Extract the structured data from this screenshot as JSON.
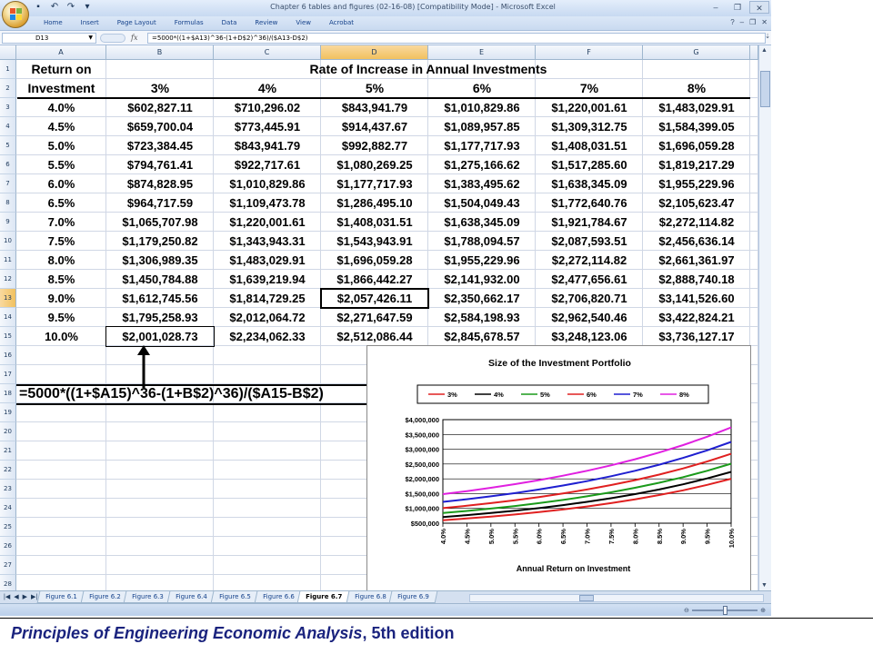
{
  "window": {
    "title": "Chapter 6 tables and figures (02-16-08)  [Compatibility Mode] - Microsoft Excel",
    "controls": [
      "–",
      "❐",
      "✕"
    ]
  },
  "ribbon": {
    "tabs": [
      "Home",
      "Insert",
      "Page Layout",
      "Formulas",
      "Data",
      "Review",
      "View",
      "Acrobat"
    ]
  },
  "formula_bar": {
    "name_box": "D13",
    "fx": "fx",
    "formula": "=5000*((1+$A13)^36-(1+D$2)^36)/($A13-D$2)"
  },
  "columns": [
    "A",
    "B",
    "C",
    "D",
    "E",
    "F",
    "G"
  ],
  "selected_column": "D",
  "rows": [
    "1",
    "2",
    "3",
    "4",
    "5",
    "6",
    "7",
    "8",
    "9",
    "10",
    "11",
    "12",
    "13",
    "14",
    "15",
    "16",
    "17",
    "18",
    "19",
    "20",
    "21",
    "22",
    "23",
    "24",
    "25",
    "26",
    "27",
    "28"
  ],
  "selected_row": "13",
  "table": {
    "header_a1": "Return on",
    "header_a2": "Investment",
    "header_title": "Rate of Increase in Annual Investments",
    "rate_headers": [
      "3%",
      "4%",
      "5%",
      "6%",
      "7%",
      "8%"
    ],
    "rows": [
      {
        "ret": "4.0%",
        "vals": [
          "$602,827.11",
          "$710,296.02",
          "$843,941.79",
          "$1,010,829.86",
          "$1,220,001.61",
          "$1,483,029.91"
        ]
      },
      {
        "ret": "4.5%",
        "vals": [
          "$659,700.04",
          "$773,445.91",
          "$914,437.67",
          "$1,089,957.85",
          "$1,309,312.75",
          "$1,584,399.05"
        ]
      },
      {
        "ret": "5.0%",
        "vals": [
          "$723,384.45",
          "$843,941.79",
          "$992,882.77",
          "$1,177,717.93",
          "$1,408,031.51",
          "$1,696,059.28"
        ]
      },
      {
        "ret": "5.5%",
        "vals": [
          "$794,761.41",
          "$922,717.61",
          "$1,080,269.25",
          "$1,275,166.62",
          "$1,517,285.60",
          "$1,819,217.29"
        ]
      },
      {
        "ret": "6.0%",
        "vals": [
          "$874,828.95",
          "$1,010,829.86",
          "$1,177,717.93",
          "$1,383,495.62",
          "$1,638,345.09",
          "$1,955,229.96"
        ]
      },
      {
        "ret": "6.5%",
        "vals": [
          "$964,717.59",
          "$1,109,473.78",
          "$1,286,495.10",
          "$1,504,049.43",
          "$1,772,640.76",
          "$2,105,623.47"
        ]
      },
      {
        "ret": "7.0%",
        "vals": [
          "$1,065,707.98",
          "$1,220,001.61",
          "$1,408,031.51",
          "$1,638,345.09",
          "$1,921,784.67",
          "$2,272,114.82"
        ]
      },
      {
        "ret": "7.5%",
        "vals": [
          "$1,179,250.82",
          "$1,343,943.31",
          "$1,543,943.91",
          "$1,788,094.57",
          "$2,087,593.51",
          "$2,456,636.14"
        ]
      },
      {
        "ret": "8.0%",
        "vals": [
          "$1,306,989.35",
          "$1,483,029.91",
          "$1,696,059.28",
          "$1,955,229.96",
          "$2,272,114.82",
          "$2,661,361.97"
        ]
      },
      {
        "ret": "8.5%",
        "vals": [
          "$1,450,784.88",
          "$1,639,219.94",
          "$1,866,442.27",
          "$2,141,932.00",
          "$2,477,656.61",
          "$2,888,740.18"
        ]
      },
      {
        "ret": "9.0%",
        "vals": [
          "$1,612,745.56",
          "$1,814,729.25",
          "$2,057,426.11",
          "$2,350,662.17",
          "$2,706,820.71",
          "$3,141,526.60"
        ]
      },
      {
        "ret": "9.5%",
        "vals": [
          "$1,795,258.93",
          "$2,012,064.72",
          "$2,271,647.59",
          "$2,584,198.93",
          "$2,962,540.46",
          "$3,422,824.21"
        ]
      },
      {
        "ret": "10.0%",
        "vals": [
          "$2,001,028.73",
          "$2,234,062.33",
          "$2,512,086.44",
          "$2,845,678.57",
          "$3,248,123.06",
          "$3,736,127.17"
        ]
      }
    ]
  },
  "formula_annotation": "=5000*((1+$A15)^36-(1+B$2)^36)/($A15-B$2)",
  "chart_data": {
    "type": "line",
    "title": "Size of the Investment Portfolio",
    "xlabel": "Annual Return on Investment",
    "ylabel": "",
    "x": [
      "4.0%",
      "4.5%",
      "5.0%",
      "5.5%",
      "6.0%",
      "6.5%",
      "7.0%",
      "7.5%",
      "8.0%",
      "8.5%",
      "9.0%",
      "9.5%",
      "10.0%"
    ],
    "yticks": [
      "$500,000",
      "$1,000,000",
      "$1,500,000",
      "$2,000,000",
      "$2,500,000",
      "$3,000,000",
      "$3,500,000",
      "$4,000,000"
    ],
    "ylim": [
      500000,
      4000000
    ],
    "grid": true,
    "legend": "top",
    "series": [
      {
        "name": "3%",
        "color": "#e02020",
        "values": [
          602827,
          659700,
          723384,
          794761,
          874829,
          964718,
          1065708,
          1179251,
          1306989,
          1450785,
          1612746,
          1795259,
          2001029
        ]
      },
      {
        "name": "4%",
        "color": "#000000",
        "values": [
          710296,
          773446,
          843942,
          922718,
          1010830,
          1109474,
          1220002,
          1343943,
          1483030,
          1639220,
          1814729,
          2012065,
          2234062
        ]
      },
      {
        "name": "5%",
        "color": "#1a9a1a",
        "values": [
          843942,
          914438,
          992883,
          1080269,
          1177718,
          1286495,
          1408032,
          1543944,
          1696059,
          1866442,
          2057426,
          2271648,
          2512086
        ]
      },
      {
        "name": "6%",
        "color": "#e02020",
        "values": [
          1010830,
          1089958,
          1177718,
          1275167,
          1383496,
          1504049,
          1638345,
          1788095,
          1955230,
          2141932,
          2350662,
          2584199,
          2845679
        ]
      },
      {
        "name": "7%",
        "color": "#1f1fd0",
        "values": [
          1220002,
          1309313,
          1408032,
          1517286,
          1638345,
          1772641,
          1921785,
          2087594,
          2272115,
          2477657,
          2706821,
          2962540,
          3248123
        ]
      },
      {
        "name": "8%",
        "color": "#e020e0",
        "values": [
          1483030,
          1584399,
          1696059,
          1819217,
          1955230,
          2105623,
          2272115,
          2456636,
          2661362,
          2888740,
          3141527,
          3422824,
          3736127
        ]
      }
    ]
  },
  "sheet_tabs": [
    "Figure 6.1",
    "Figure 6.2",
    "Figure 6.3",
    "Figure 6.4",
    "Figure 6.5",
    "Figure 6.6",
    "Figure 6.7",
    "Figure 6.8",
    "Figure 6.9"
  ],
  "active_sheet": "Figure 6.7",
  "footer": {
    "title": "Principles of Engineering Economic Analysis",
    "edition": ", 5th edition"
  }
}
